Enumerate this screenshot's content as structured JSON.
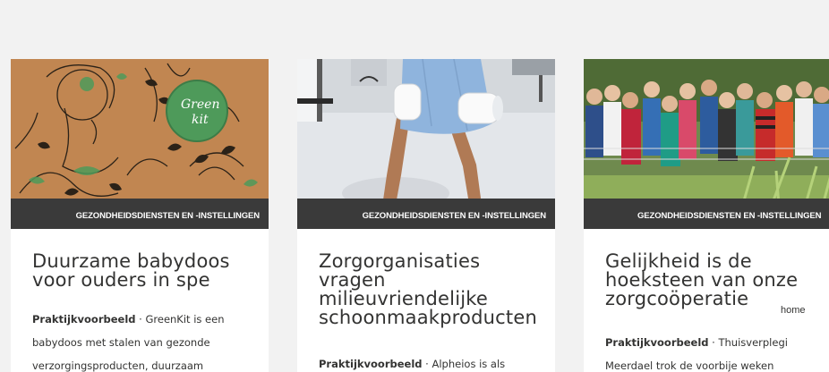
{
  "cards": [
    {
      "category": "GEZONDHEIDSDIENSTEN EN -INSTELLINGEN",
      "title_lines": [
        "Duurzame babydoos",
        "voor ouders in spe"
      ],
      "body_label": "Praktijkvoorbeeld",
      "body_separator": " · ",
      "body_text": "GreenKit is een babydoos met stalen van gezonde verzorgingsproducten, duurzaam",
      "logo_text": [
        "Green",
        "kit"
      ]
    },
    {
      "category": "GEZONDHEIDSDIENSTEN EN -INSTELLINGEN",
      "title_lines": [
        "Zorgorganisaties",
        "vragen",
        "milieuvriendelijke",
        "schoonmaakproducten"
      ],
      "body_label": "Praktijkvoorbeeld",
      "body_separator": " · ",
      "body_text": "Alpheios is als"
    },
    {
      "category": "GEZONDHEIDSDIENSTEN EN -INSTELLINGEN",
      "title_lines": [
        "Gelijkheid is de",
        "hoeksteen van onze",
        "zorgcoöperatie"
      ],
      "body_label": "Praktijkvoorbeeld",
      "body_separator": " · ",
      "body_text": "Thuisverplegi Meerdael trok de voorbije weken"
    }
  ],
  "side_link": "home",
  "colors": {
    "background": "#f2f2f2",
    "card": "#ffffff",
    "band": "#3a3a3a",
    "text": "#333332",
    "kraft": "#c48a55"
  }
}
